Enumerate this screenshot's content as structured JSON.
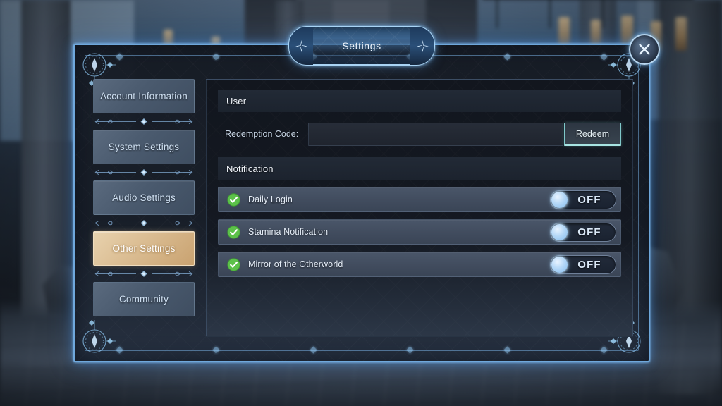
{
  "window": {
    "title": "Settings",
    "close_label": "close-icon"
  },
  "sidebar": {
    "items": [
      {
        "label": "Account Information",
        "selected": false
      },
      {
        "label": "System Settings",
        "selected": false
      },
      {
        "label": "Audio Settings",
        "selected": false
      },
      {
        "label": "Other Settings",
        "selected": true
      },
      {
        "label": "Community",
        "selected": false
      }
    ]
  },
  "content": {
    "user_section": {
      "header": "User",
      "redemption": {
        "label": "Redemption Code:",
        "value": "",
        "placeholder": "",
        "button_label": "Redeem"
      }
    },
    "notification_section": {
      "header": "Notification",
      "rows": [
        {
          "label": "Daily Login",
          "state": "OFF",
          "enabled": true
        },
        {
          "label": "Stamina Notification",
          "state": "OFF",
          "enabled": true
        },
        {
          "label": "Mirror of the Otherworld",
          "state": "OFF",
          "enabled": true
        }
      ]
    }
  },
  "colors": {
    "panel_border": "#6fa8dc",
    "selected_item": "#dcbf95",
    "check_green": "#5cc14a",
    "toggle_knob": "#b5d8f7",
    "redeem_border": "#7fc7c9"
  }
}
